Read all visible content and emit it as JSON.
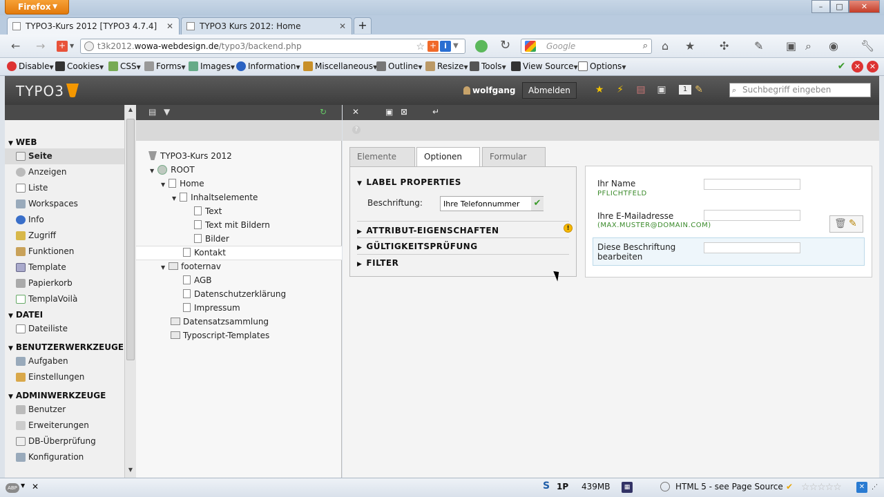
{
  "browser": {
    "app_button": "Firefox",
    "tabs": [
      {
        "label": "TYPO3-Kurs 2012 [TYPO3 4.7.4]",
        "active": true
      },
      {
        "label": "TYPO3 Kurs 2012: Home",
        "active": false
      }
    ],
    "url_prefix": "t3k2012.",
    "url_domain": "wowa-webdesign.de",
    "url_path": "/typo3/backend.php",
    "search_placeholder": "Google",
    "devbar": {
      "items": [
        "Disable",
        "Cookies",
        "CSS",
        "Forms",
        "Images",
        "Information",
        "Miscellaneous",
        "Outline",
        "Resize",
        "Tools",
        "View Source",
        "Options"
      ]
    }
  },
  "typo3": {
    "logo": "TYPO3",
    "username": "wolfgang",
    "logout_label": "Abmelden",
    "search_placeholder": "Suchbegriff eingeben",
    "workspace_badge": "1"
  },
  "modules": {
    "groups": [
      {
        "label": "WEB",
        "items": [
          "Seite",
          "Anzeigen",
          "Liste",
          "Workspaces",
          "Info",
          "Zugriff",
          "Funktionen",
          "Template",
          "Papierkorb",
          "TemplaVoilà"
        ]
      },
      {
        "label": "DATEI",
        "items": [
          "Dateiliste"
        ]
      },
      {
        "label": "BENUTZERWERKZEUGE",
        "items": [
          "Aufgaben",
          "Einstellungen"
        ]
      },
      {
        "label": "ADMINWERKZEUGE",
        "items": [
          "Benutzer",
          "Erweiterungen",
          "DB-Überprüfung",
          "Konfiguration"
        ]
      }
    ],
    "active_item": "Seite"
  },
  "tree": {
    "nodes": [
      "TYPO3-Kurs 2012",
      "ROOT",
      "Home",
      "Inhaltselemente",
      "Text",
      "Text mit Bildern",
      "Bilder",
      "Kontakt",
      "footernav",
      "AGB",
      "Datenschutzerklärung",
      "Impressum",
      "Datensatzsammlung",
      "Typoscript-Templates"
    ],
    "selected": "Kontakt"
  },
  "form_wizard": {
    "tabs": [
      "Elemente",
      "Optionen",
      "Formular"
    ],
    "active_tab": "Optionen",
    "sections": {
      "label_properties": "LABEL PROPERTIES",
      "attribute": "ATTRIBUT-EIGENSCHAFTEN",
      "validation": "GÜLTIGKEITSPRÜFUNG",
      "filter": "FILTER"
    },
    "label_field_label": "Beschriftung:",
    "label_field_value": "Ihre Telefonnummer"
  },
  "preview": {
    "fields": [
      {
        "label": "Ihr Name",
        "sub": "PFLICHTFELD"
      },
      {
        "label": "Ihre E-Mailadresse",
        "sub": "(MAX.MUSTER@DOMAIN.COM)"
      },
      {
        "label": "Diese Beschriftung bearbeiten",
        "sub": ""
      }
    ]
  },
  "statusbar": {
    "left_badge": "ABP",
    "skype": "S",
    "onepw": "1P",
    "memory": "439MB",
    "html5": "HTML 5 - see Page Source"
  }
}
